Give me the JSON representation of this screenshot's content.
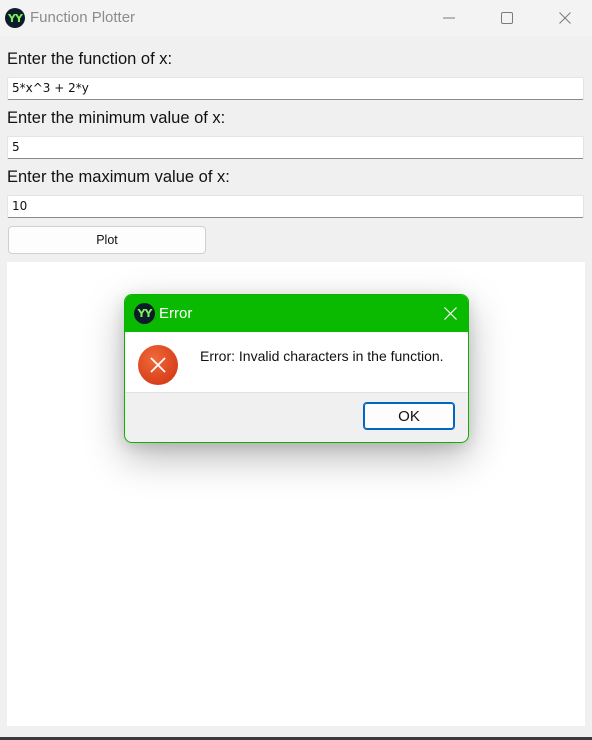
{
  "window": {
    "title": "Function Plotter",
    "icon": "app-logo-icon"
  },
  "form": {
    "function_label": "Enter the function of x:",
    "function_value": "5*x^3 + 2*y",
    "min_label": "Enter the minimum value of x:",
    "min_value": "5",
    "max_label": "Enter the maximum value of x:",
    "max_value": "10",
    "plot_button": "Plot"
  },
  "dialog": {
    "title": "Error",
    "message": "Error: Invalid characters in the function.",
    "ok_button": "OK",
    "icon": "error-icon",
    "accent_color": "#0aba00"
  },
  "colors": {
    "window_bg": "#f0f0f0",
    "plot_area": "#ffffff",
    "error_red": "#d8401b",
    "focus_blue": "#0067c0"
  }
}
